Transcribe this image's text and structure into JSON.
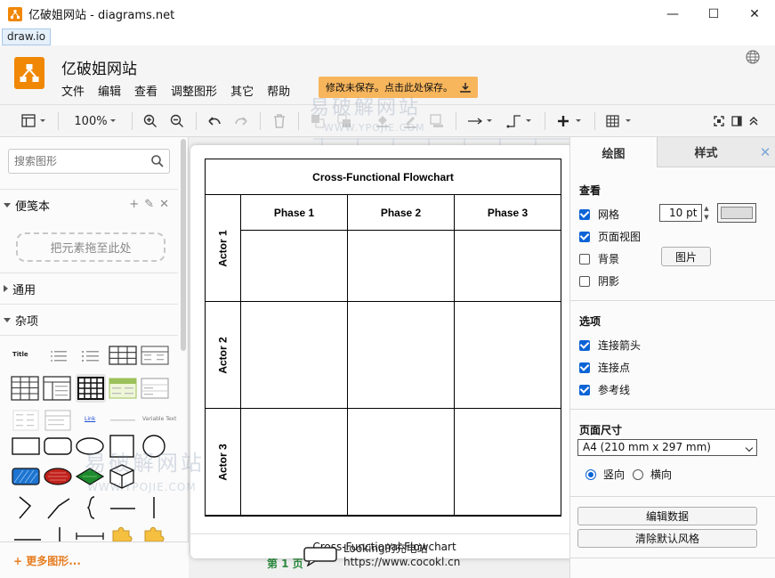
{
  "window": {
    "title": "亿破姐网站 - diagrams.net",
    "minimize": "—",
    "maximize": "☐",
    "close": "✕"
  },
  "menubar": {
    "tag": "draw.io"
  },
  "header": {
    "app_title": "亿破姐网站",
    "menus": [
      "文件",
      "编辑",
      "查看",
      "调整图形",
      "其它",
      "帮助"
    ],
    "save_notice": "修改未保存。点击此处保存。"
  },
  "toolbar": {
    "zoom": "100%"
  },
  "sidebar": {
    "search_placeholder": "搜索图形",
    "scratchpad_label": "便笺本",
    "drop_zone": "把元素拖至此处",
    "general_label": "通用",
    "misc_label": "杂项",
    "more_shapes": "+ 更多图形...",
    "shape_labels": {
      "title": "Title",
      "link": "Link",
      "variable_text": "Variable Text"
    }
  },
  "preview": {
    "chart_title": "Cross-Functional Flowchart",
    "phases": [
      "Phase 1",
      "Phase 2",
      "Phase 3"
    ],
    "actors": [
      "Actor 1",
      "Actor 2",
      "Actor 3"
    ],
    "footer": "Cross-Functional Flowchart"
  },
  "canvas": {
    "page_tab": "第 1 页"
  },
  "rpanel": {
    "tabs": [
      "绘图",
      "样式"
    ],
    "close_tab": "✕",
    "view_head": "查看",
    "grid": "网格",
    "grid_size": "10 pt",
    "page_view": "页面视图",
    "background": "背景",
    "image_button": "图片",
    "shadow": "阴影",
    "options_head": "选项",
    "connection_arrows": "连接箭头",
    "connection_points": "连接点",
    "guides": "参考线",
    "page_size_head": "页面尺寸",
    "paper_size": "A4 (210 mm x 297 mm)",
    "portrait": "竖向",
    "landscape": "横向",
    "edit_data": "编辑数据",
    "clear_style": "清除默认风格"
  },
  "watermarks": {
    "site_cn": "易破解网站",
    "site_en": "WWW.YPOJIE.COM",
    "caption_name": "Looking的充电站",
    "caption_url": "https://www.cocokl.cn"
  },
  "colors": {
    "accent": "#f08705",
    "check_blue": "#0b63d6",
    "banner": "#f7b55c"
  }
}
